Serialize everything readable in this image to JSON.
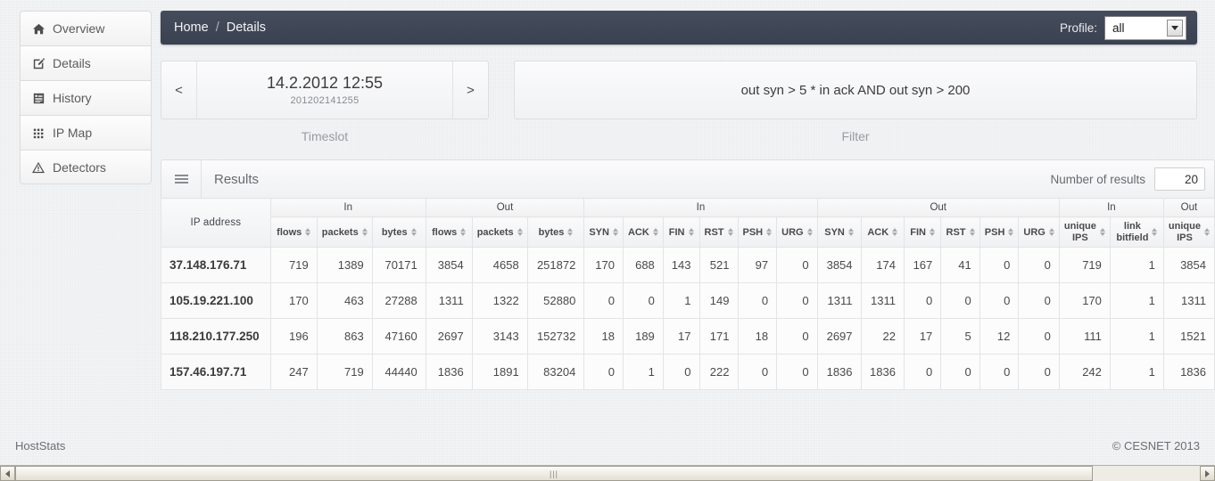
{
  "sidebar": {
    "items": [
      {
        "label": "Overview",
        "icon": "home-icon"
      },
      {
        "label": "Details",
        "icon": "edit-square-icon"
      },
      {
        "label": "History",
        "icon": "list-document-icon"
      },
      {
        "label": "IP Map",
        "icon": "grid-icon"
      },
      {
        "label": "Detectors",
        "icon": "warning-triangle-icon"
      }
    ]
  },
  "topbar": {
    "breadcrumb": {
      "home": "Home",
      "separator": "/",
      "current": "Details"
    },
    "profile": {
      "label": "Profile:",
      "value": "all"
    }
  },
  "timeslot": {
    "caption": "Timeslot",
    "prev": "<",
    "next": ">",
    "datetime": "14.2.2012 12:55",
    "code": "201202141255"
  },
  "filter": {
    "caption": "Filter",
    "expression": "out syn > 5 * in ack AND out syn > 200"
  },
  "results": {
    "title": "Results",
    "menu_icon": "hamburger-icon",
    "number_of_results_label": "Number of results",
    "number_of_results_value": "20",
    "groups": [
      {
        "label": "",
        "span": 1
      },
      {
        "label": "In",
        "span": 3
      },
      {
        "label": "Out",
        "span": 3
      },
      {
        "label": "In",
        "span": 6
      },
      {
        "label": "Out",
        "span": 6
      },
      {
        "label": "In",
        "span": 2
      },
      {
        "label": "Out",
        "span": 1
      }
    ],
    "columns": [
      {
        "key": "ip",
        "label": "IP address",
        "sortable": false,
        "rowspan": 2
      },
      {
        "key": "in_flows",
        "label": "flows",
        "sortable": true
      },
      {
        "key": "in_packets",
        "label": "packets",
        "sortable": true
      },
      {
        "key": "in_bytes",
        "label": "bytes",
        "sortable": true
      },
      {
        "key": "out_flows",
        "label": "flows",
        "sortable": true
      },
      {
        "key": "out_packets",
        "label": "packets",
        "sortable": true
      },
      {
        "key": "out_bytes",
        "label": "bytes",
        "sortable": true
      },
      {
        "key": "in_syn",
        "label": "SYN",
        "sortable": true
      },
      {
        "key": "in_ack",
        "label": "ACK",
        "sortable": true
      },
      {
        "key": "in_fin",
        "label": "FIN",
        "sortable": true
      },
      {
        "key": "in_rst",
        "label": "RST",
        "sortable": true
      },
      {
        "key": "in_psh",
        "label": "PSH",
        "sortable": true
      },
      {
        "key": "in_urg",
        "label": "URG",
        "sortable": true
      },
      {
        "key": "out_syn",
        "label": "SYN",
        "sortable": true
      },
      {
        "key": "out_ack",
        "label": "ACK",
        "sortable": true
      },
      {
        "key": "out_fin",
        "label": "FIN",
        "sortable": true
      },
      {
        "key": "out_rst",
        "label": "RST",
        "sortable": true
      },
      {
        "key": "out_psh",
        "label": "PSH",
        "sortable": true
      },
      {
        "key": "out_urg",
        "label": "URG",
        "sortable": true
      },
      {
        "key": "in_uips",
        "label": "unique\nIPS",
        "sortable": true
      },
      {
        "key": "in_link",
        "label": "link\nbitfield",
        "sortable": true
      },
      {
        "key": "out_uips",
        "label": "unique\nIPS",
        "sortable": true
      }
    ],
    "rows": [
      {
        "ip": "37.148.176.71",
        "in_flows": "719",
        "in_packets": "1389",
        "in_bytes": "70171",
        "out_flows": "3854",
        "out_packets": "4658",
        "out_bytes": "251872",
        "in_syn": "170",
        "in_ack": "688",
        "in_fin": "143",
        "in_rst": "521",
        "in_psh": "97",
        "in_urg": "0",
        "out_syn": "3854",
        "out_ack": "174",
        "out_fin": "167",
        "out_rst": "41",
        "out_psh": "0",
        "out_urg": "0",
        "in_uips": "719",
        "in_link": "1",
        "out_uips": "3854"
      },
      {
        "ip": "105.19.221.100",
        "in_flows": "170",
        "in_packets": "463",
        "in_bytes": "27288",
        "out_flows": "1311",
        "out_packets": "1322",
        "out_bytes": "52880",
        "in_syn": "0",
        "in_ack": "0",
        "in_fin": "1",
        "in_rst": "149",
        "in_psh": "0",
        "in_urg": "0",
        "out_syn": "1311",
        "out_ack": "1311",
        "out_fin": "0",
        "out_rst": "0",
        "out_psh": "0",
        "out_urg": "0",
        "in_uips": "170",
        "in_link": "1",
        "out_uips": "1311"
      },
      {
        "ip": "118.210.177.250",
        "in_flows": "196",
        "in_packets": "863",
        "in_bytes": "47160",
        "out_flows": "2697",
        "out_packets": "3143",
        "out_bytes": "152732",
        "in_syn": "18",
        "in_ack": "189",
        "in_fin": "17",
        "in_rst": "171",
        "in_psh": "18",
        "in_urg": "0",
        "out_syn": "2697",
        "out_ack": "22",
        "out_fin": "17",
        "out_rst": "5",
        "out_psh": "12",
        "out_urg": "0",
        "in_uips": "111",
        "in_link": "1",
        "out_uips": "1521"
      },
      {
        "ip": "157.46.197.71",
        "in_flows": "247",
        "in_packets": "719",
        "in_bytes": "44440",
        "out_flows": "1836",
        "out_packets": "1891",
        "out_bytes": "83204",
        "in_syn": "0",
        "in_ack": "1",
        "in_fin": "0",
        "in_rst": "222",
        "in_psh": "0",
        "in_urg": "0",
        "out_syn": "1836",
        "out_ack": "1836",
        "out_fin": "0",
        "out_rst": "0",
        "out_psh": "0",
        "out_urg": "0",
        "in_uips": "242",
        "in_link": "1",
        "out_uips": "1836"
      }
    ]
  },
  "footer": {
    "left": "HostStats",
    "right": "© CESNET 2013"
  },
  "scrollbar": {
    "grip": "|||"
  }
}
